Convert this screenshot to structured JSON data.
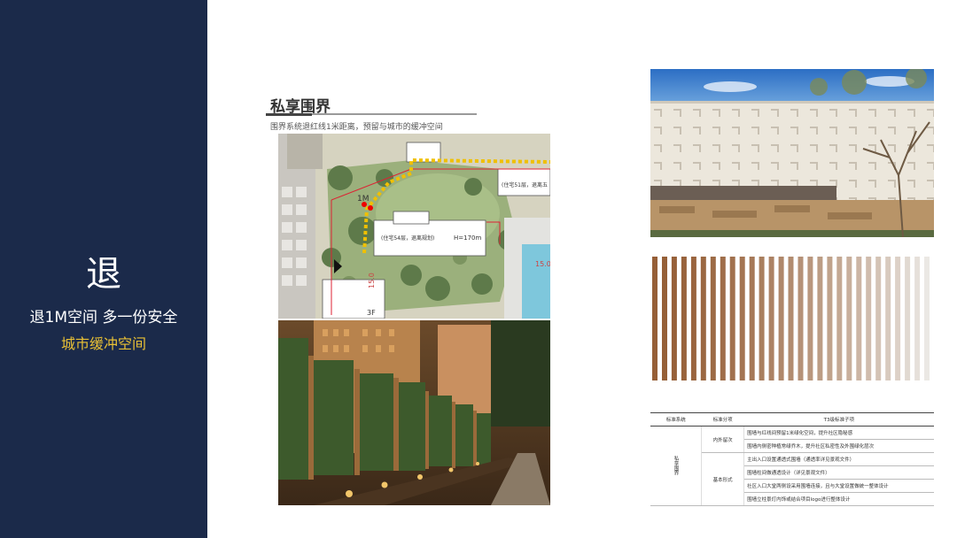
{
  "sidebar": {
    "big_char": "退",
    "subtitle": "退1M空间 多一份安全",
    "highlight": "城市缓冲空间",
    "bg_color": "#1b2a4a",
    "accent_color": "#e8c035"
  },
  "section": {
    "title": "私享围界",
    "description": "围界系统退红线1米距离，预留与城市的缓冲空间"
  },
  "site_plan": {
    "label_1m": "1M",
    "label_tower_a": "(住宅51层，退离五",
    "label_tower_b": "(住宅54层，退离规划)",
    "label_height": "H=170m",
    "label_3f": "3F",
    "label_dim_1": "15.0",
    "label_dim_2": "15.0"
  },
  "table": {
    "headers": [
      "标准系统",
      "标准分项",
      "T3级标准子项"
    ],
    "category": "私享围界",
    "groups": [
      {
        "name": "内外留次",
        "items": [
          "围墙与红线间预留1米绿化空间，提升社区隐秘感",
          "围墙内侧密种植常绿乔木，提升社区私密性及外围绿化层次"
        ]
      },
      {
        "name": "基本形式",
        "items": [
          "主出入口设置通透式围墙（通透率详见景观文件）",
          "围墙柱间做通透设计（详见景观文件）",
          "社区入口大堂两侧设采用围墙连接，且与大堂设置做统一整体设计",
          "围墙立柱景灯内饰或结合项目logo进行整体设计"
        ]
      }
    ]
  }
}
